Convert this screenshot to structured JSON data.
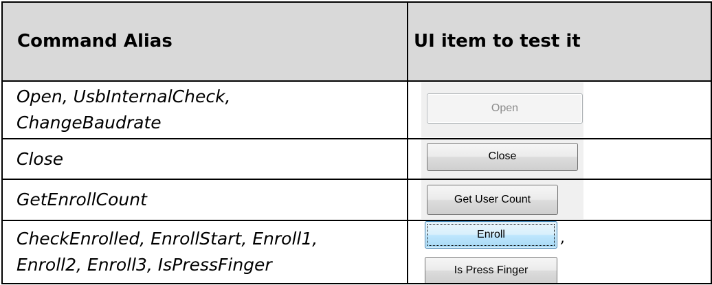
{
  "table": {
    "headers": {
      "command_alias": "Command Alias",
      "ui_item": "UI item to test it"
    },
    "rows": [
      {
        "alias_lines": [
          "Open, UsbInternalCheck,",
          "ChangeBaudrate"
        ],
        "buttons": [
          {
            "label": "Open",
            "state": "disabled"
          }
        ]
      },
      {
        "alias_lines": [
          "Close"
        ],
        "buttons": [
          {
            "label": "Close",
            "state": "normal"
          }
        ]
      },
      {
        "alias_lines": [
          "GetEnrollCount"
        ],
        "buttons": [
          {
            "label": "Get User Count",
            "state": "normal"
          }
        ]
      },
      {
        "alias_lines": [
          "CheckEnrolled, EnrollStart, Enroll1,",
          "Enroll2, Enroll3, IsPressFinger"
        ],
        "buttons": [
          {
            "label": "Enroll",
            "state": "focused"
          },
          {
            "label": "Is Press Finger",
            "state": "normal"
          }
        ],
        "separator": ","
      }
    ]
  },
  "colors": {
    "header_background": "#d9d9d9",
    "border": "#000000",
    "button_panel": "#f0f0f0"
  }
}
